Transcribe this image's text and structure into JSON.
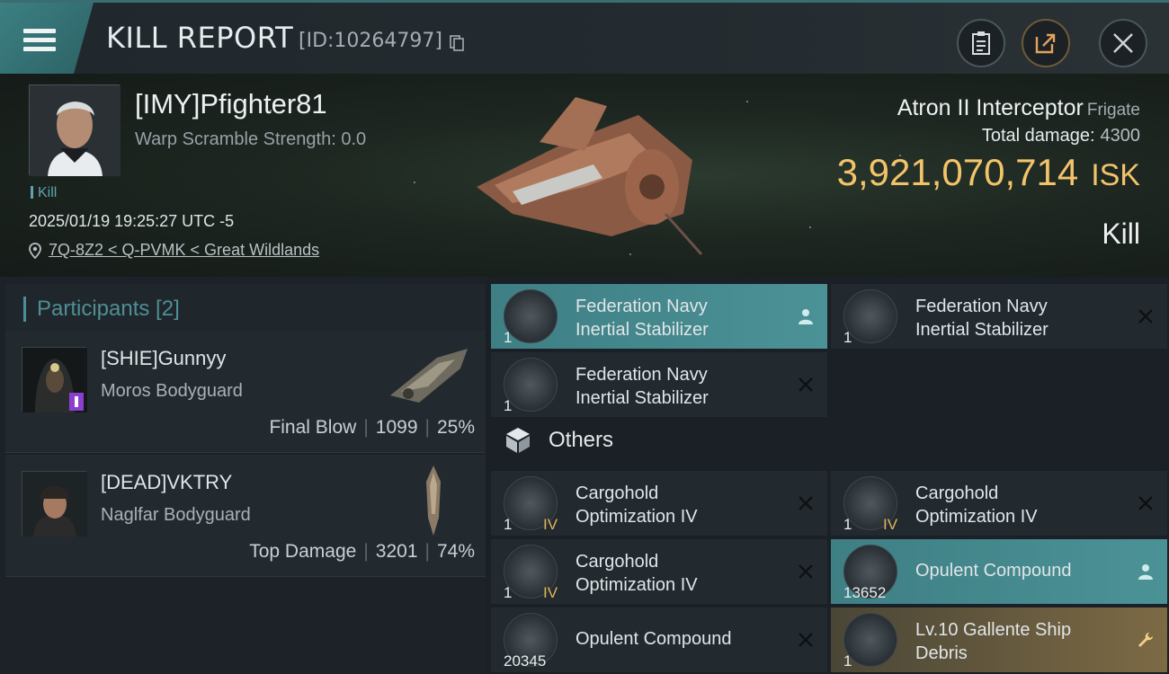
{
  "header": {
    "title": "KILL REPORT",
    "report_id": "[ID:10264797]"
  },
  "victim": {
    "name": "[IMY]Pfighter81",
    "warp_scramble": "Warp Scramble Strength: 0.0",
    "tag": "Kill",
    "datetime": "2025/01/19 19:25:27 UTC -5",
    "location": "7Q-8Z2 < Q-PVMK < Great Wildlands",
    "ship": "Atron II Interceptor",
    "ship_class": "Frigate",
    "total_damage_label": "Total damage:",
    "total_damage": "4300",
    "isk_value": "3,921,070,714",
    "isk_unit": "ISK",
    "outcome": "Kill"
  },
  "participants": {
    "heading": "Participants [2]",
    "list": [
      {
        "name": "[SHIE]Gunnyy",
        "ship": "Moros Bodyguard",
        "role": "Final Blow",
        "damage": "1099",
        "percent": "25%"
      },
      {
        "name": "[DEAD]VKTRY",
        "ship": "Naglfar Bodyguard",
        "role": "Top Damage",
        "damage": "3201",
        "percent": "74%"
      }
    ]
  },
  "items": {
    "others_heading": "Others",
    "modules": [
      {
        "line1": "Federation Navy",
        "line2": "Inertial Stabilizer",
        "qty": "1",
        "state": "dropped"
      },
      {
        "line1": "Federation Navy",
        "line2": "Inertial Stabilizer",
        "qty": "1",
        "state": "destroyed"
      },
      {
        "line1": "Federation Navy",
        "line2": "Inertial Stabilizer",
        "qty": "1",
        "state": "destroyed"
      }
    ],
    "others": [
      {
        "line1": "Cargohold",
        "line2": "Optimization IV",
        "qty": "1",
        "level": "IV",
        "state": "destroyed"
      },
      {
        "line1": "Cargohold",
        "line2": "Optimization IV",
        "qty": "1",
        "level": "IV",
        "state": "destroyed"
      },
      {
        "line1": "Cargohold",
        "line2": "Optimization IV",
        "qty": "1",
        "level": "IV",
        "state": "destroyed"
      },
      {
        "line1": "Opulent Compound",
        "qty": "13652",
        "state": "dropped"
      },
      {
        "line1": "Opulent Compound",
        "qty": "20345",
        "state": "destroyed"
      },
      {
        "line1": "Lv.10 Gallente Ship",
        "line2": "Debris",
        "qty": "1",
        "state": "salvage"
      }
    ]
  },
  "colors": {
    "accent_teal": "#4b9296",
    "isk_gold": "#f2c46a",
    "salvage_gold": "#7d6a45"
  }
}
